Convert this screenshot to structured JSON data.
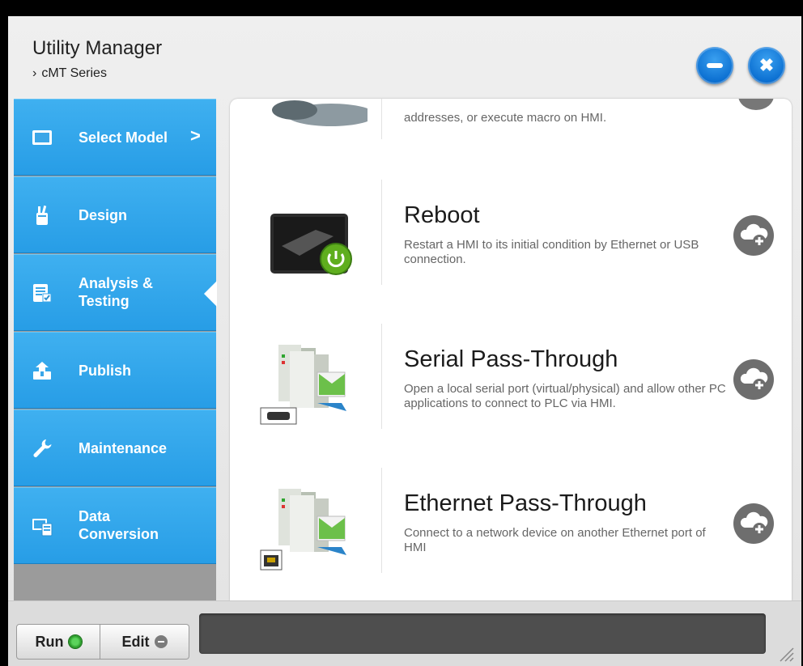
{
  "app": {
    "title": "Utility Manager",
    "breadcrumb": "cMT Series",
    "breadcrumb_chevron": "›"
  },
  "window_controls": {
    "minimize_icon": "minus-icon",
    "close_icon": "close-icon",
    "close_glyph": "✖"
  },
  "sidebar": {
    "items": [
      {
        "label": "Select Model",
        "icon": "monitor-icon",
        "arrow": ">"
      },
      {
        "label": "Design",
        "icon": "pencil-cup-icon"
      },
      {
        "label": "Analysis &\nTesting",
        "icon": "checklist-icon",
        "active": true
      },
      {
        "label": "Publish",
        "icon": "upload-icon"
      },
      {
        "label": "Maintenance",
        "icon": "wrench-icon"
      },
      {
        "label": "Data\nConversion",
        "icon": "convert-icon"
      }
    ]
  },
  "content": {
    "partial_item_desc": "addresses, or execute macro on HMI.",
    "items": [
      {
        "title": "Reboot",
        "desc": "Restart a HMI to its initial condition by Ethernet or USB connection.",
        "icon": "reboot-hmi-icon"
      },
      {
        "title": "Serial Pass-Through",
        "desc": "Open a local serial port (virtual/physical) and allow other PC applications to connect to PLC via HMI.",
        "icon": "serial-pass-through-icon"
      },
      {
        "title": "Ethernet Pass-Through",
        "desc": "Connect to a network device on another Ethernet port of HMI",
        "icon": "ethernet-pass-through-icon"
      }
    ],
    "add_icon": "cloud-plus-icon"
  },
  "bottom": {
    "run_label": "Run",
    "edit_label": "Edit"
  },
  "colors": {
    "sidebar_blue": "#2da3ea",
    "button_blue": "#0b6fd1",
    "sidebar_gray": "#9b9b9b",
    "status_bar": "#4e4e4e"
  }
}
